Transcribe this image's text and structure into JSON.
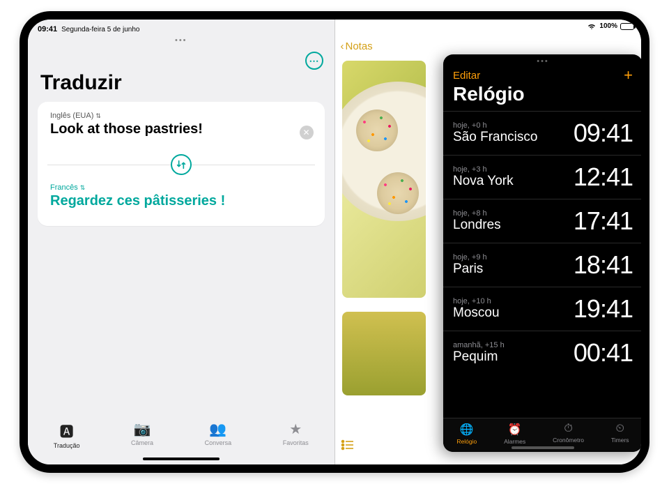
{
  "status": {
    "time": "09:41",
    "date": "Segunda-feira 5 de junho",
    "battery": "100%"
  },
  "translate": {
    "title": "Traduzir",
    "source_lang": "Inglês (EUA)",
    "source_text": "Look at those pastries!",
    "target_lang": "Francês",
    "target_text": "Regardez ces pâtisseries !",
    "tabs": [
      {
        "label": "Tradução"
      },
      {
        "label": "Câmera"
      },
      {
        "label": "Conversa"
      },
      {
        "label": "Favoritas"
      }
    ]
  },
  "notes": {
    "back_label": "Notas"
  },
  "clock": {
    "edit": "Editar",
    "title": "Relógio",
    "cities": [
      {
        "meta": "hoje, +0 h",
        "city": "São Francisco",
        "time": "09:41"
      },
      {
        "meta": "hoje, +3 h",
        "city": "Nova York",
        "time": "12:41"
      },
      {
        "meta": "hoje, +8 h",
        "city": "Londres",
        "time": "17:41"
      },
      {
        "meta": "hoje, +9 h",
        "city": "Paris",
        "time": "18:41"
      },
      {
        "meta": "hoje, +10 h",
        "city": "Moscou",
        "time": "19:41"
      },
      {
        "meta": "amanhã, +15 h",
        "city": "Pequim",
        "time": "00:41"
      }
    ],
    "tabs": [
      {
        "label": "Relógio"
      },
      {
        "label": "Alarmes"
      },
      {
        "label": "Cronômetro"
      },
      {
        "label": "Timers"
      }
    ]
  }
}
